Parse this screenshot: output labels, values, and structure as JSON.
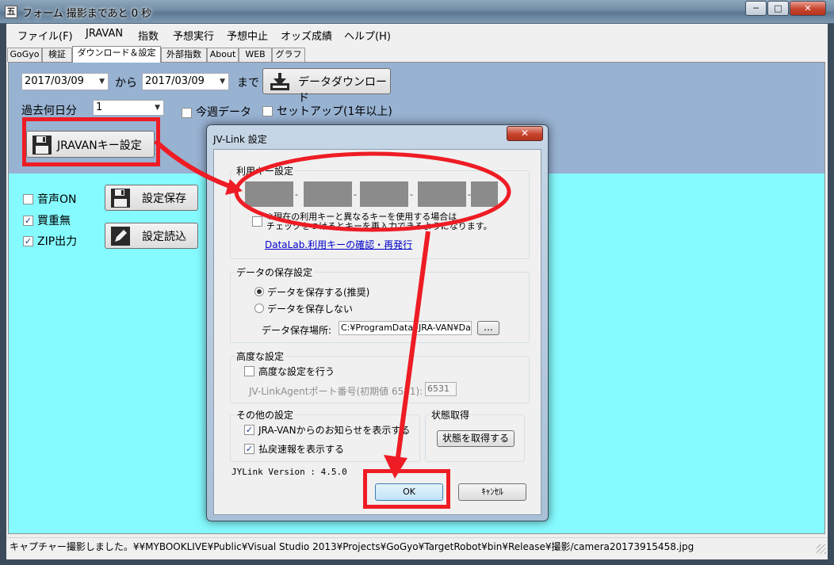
{
  "window": {
    "title": "フォーム 撮影まであと 0 秒",
    "app_icon": "五",
    "min": "─",
    "max": "□",
    "close": "✕"
  },
  "menu": [
    "ファイル(F)",
    "JRAVAN",
    "指数",
    "予想実行",
    "予想中止",
    "オッズ成績",
    "ヘルプ(H)"
  ],
  "tabs": [
    {
      "label": "GoGyo"
    },
    {
      "label": "検証"
    },
    {
      "label": "ダウンロード＆設定",
      "active": true
    },
    {
      "label": "外部指数"
    },
    {
      "label": "About"
    },
    {
      "label": "WEB"
    },
    {
      "label": "グラフ"
    }
  ],
  "download": {
    "from_date": "2017/03/09",
    "from_label": "から",
    "to_date": "2017/03/09",
    "to_label": "まで",
    "button": "データダウンロード",
    "past_days_label": "過去何日分",
    "past_days_value": "1",
    "this_week": "今週データ",
    "setup": "セットアップ(1年以上)",
    "key_button": "JRAVANキー設定"
  },
  "options": {
    "sound": {
      "label": "音声ON",
      "checked": false
    },
    "no_buy": {
      "label": "買重無",
      "checked": true
    },
    "zip": {
      "label": "ZIP出力",
      "checked": true
    },
    "save_button": "設定保存",
    "load_button": "設定読込"
  },
  "statusbar": "キャプチャー撮影しました。¥¥MYBOOKLIVE¥Public¥Visual Studio 2013¥Projects¥GoGyo¥TargetRobot¥bin¥Release¥撮影/camera20173915458.jpg",
  "dialog": {
    "title": "JV-Link 設定",
    "close": "✕",
    "key_group": "利用キー設定",
    "key_note_1": "※現在の利用キーと異なるキーを使用する場合は",
    "key_note_2": "チェックをつけるとキーを再入力できるようになります。",
    "key_link": "DataLab.利用キーの確認・再発行",
    "save_group": "データの保存設定",
    "save_yes": "データを保存する(推奨)",
    "save_no": "データを保存しない",
    "save_path_label": "データ保存場所:",
    "save_path": "C:¥ProgramData¥JRA-VAN¥Data",
    "browse": "...",
    "adv_group": "高度な設定",
    "adv_check": "高度な設定を行う",
    "port_label": "JV-LinkAgentポート番号(初期値 6531):",
    "port": "6531",
    "other_group": "その他の設定",
    "notice": "JRA-VANからのお知らせを表示する",
    "refund": "払戻速報を表示する",
    "status_group": "状態取得",
    "status_button": "状態を取得する",
    "version": "JYLink Version : 4.5.0",
    "ok": "OK",
    "cancel": "ｷｬﾝｾﾙ"
  },
  "colors": {
    "pane": "#85fbff",
    "pane_top": "#98b2d2",
    "annotation": "#ee1c24"
  }
}
